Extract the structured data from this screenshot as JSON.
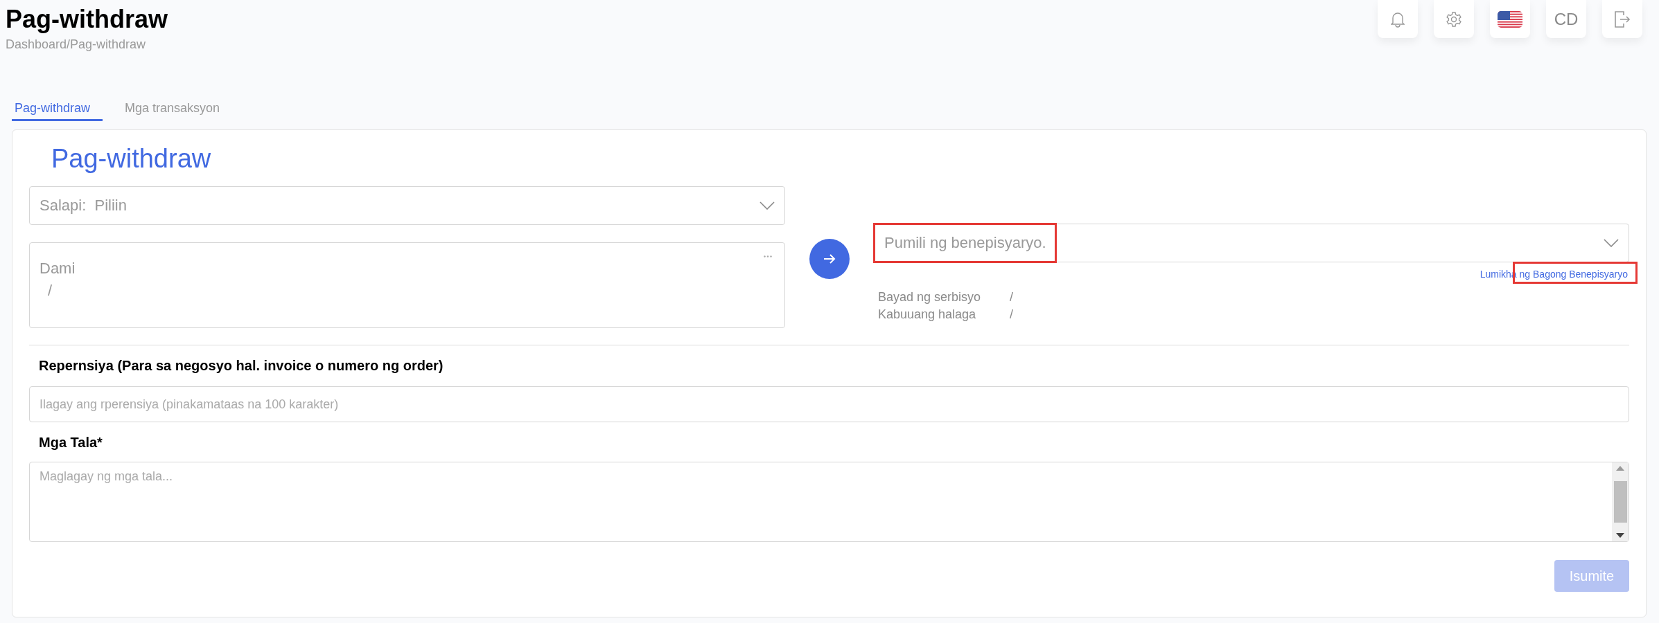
{
  "header": {
    "title": "Pag-withdraw",
    "breadcrumb": "Dashboard/Pag-withdraw",
    "user_initials": "CD"
  },
  "tabs": [
    {
      "label": "Pag-withdraw",
      "selected": true
    },
    {
      "label": "Mga transaksyon",
      "selected": false
    }
  ],
  "form": {
    "title": "Pag-withdraw",
    "currency": {
      "label": "Salapi:",
      "placeholder": "Piliin"
    },
    "amount": {
      "label": "Dami",
      "value": "/"
    },
    "beneficiary": {
      "placeholder": "Pumili ng benepisyaryo.",
      "annotated": true
    },
    "create_link": {
      "label": "Lumikha ng Bagong Benepisyaryo",
      "annotated": true
    },
    "summary": [
      {
        "label": "Bayad ng serbisyo",
        "value": "/"
      },
      {
        "label": "Kabuuang halaga",
        "value": "/"
      }
    ],
    "reference": {
      "label": "Repernsiya (Para sa negosyo hal. invoice o numero ng order)",
      "placeholder": "Ilagay ang rperensiya (pinakamataas na 100 karakter)"
    },
    "notes": {
      "label": "Mga Tala*",
      "placeholder": "Maglagay ng mga tala..."
    },
    "submit": {
      "label": "Isumite",
      "disabled": true
    }
  }
}
